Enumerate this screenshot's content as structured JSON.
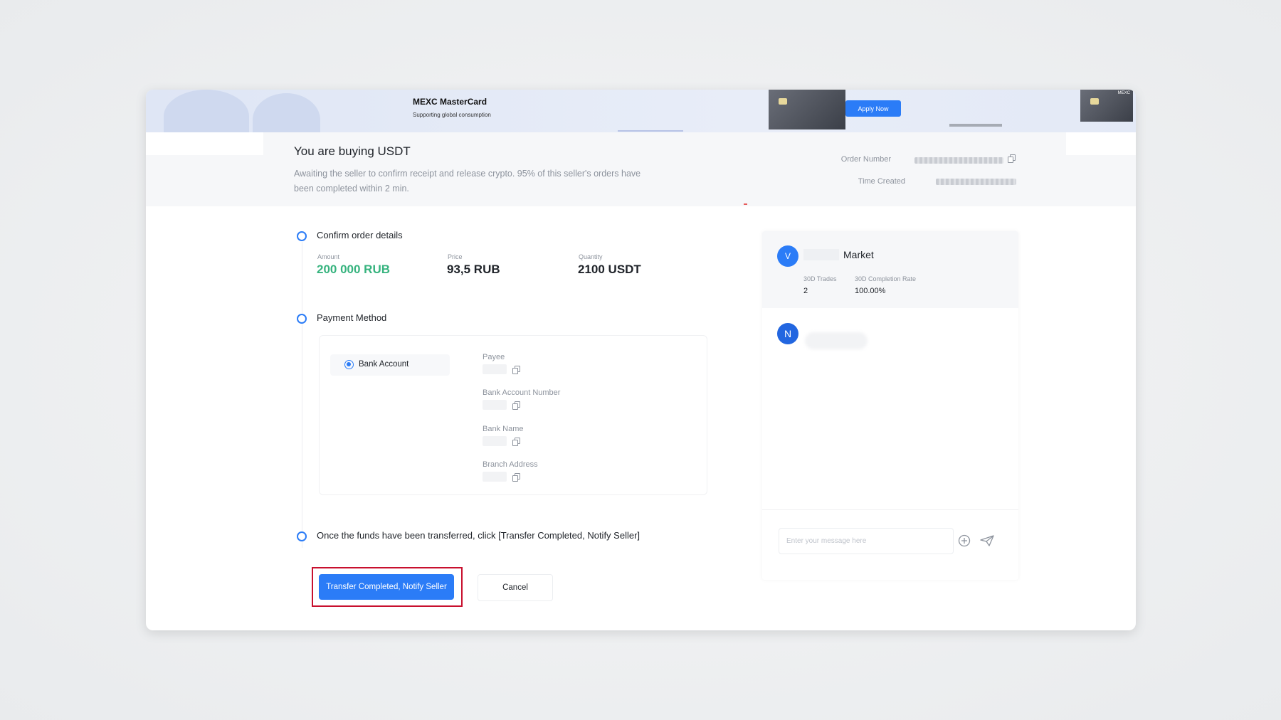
{
  "banner": {
    "title": "MEXC MasterCard",
    "subtitle": "Supporting global consumption",
    "apply_label": "Apply Now",
    "card_logo": "MEXC"
  },
  "order": {
    "title": "You are buying USDT",
    "description": "Awaiting the seller to confirm receipt and release crypto. 95% of this seller's orders have been completed within 2 min.",
    "order_number_label": "Order Number",
    "time_created_label": "Time Created"
  },
  "steps": {
    "confirm": {
      "label": "Confirm order details",
      "amount_label": "Amount",
      "amount_value": "200 000 RUB",
      "price_label": "Price",
      "price_value": "93,5 RUB",
      "quantity_label": "Quantity",
      "quantity_value": "2100 USDT"
    },
    "payment": {
      "label": "Payment Method",
      "method": "Bank Account",
      "fields": [
        "Payee",
        "Bank Account Number",
        "Bank Name",
        "Branch Address"
      ]
    },
    "transfer": {
      "label": "Once the funds have been transferred, click [Transfer Completed, Notify Seller]"
    }
  },
  "actions": {
    "primary_label": "Transfer Completed, Notify Seller",
    "cancel_label": "Cancel"
  },
  "chat": {
    "seller_initial": "V",
    "seller_name": "Market",
    "trades_label": "30D Trades",
    "trades_value": "2",
    "completion_label": "30D Completion Rate",
    "completion_value": "100.00%",
    "user_initial": "N",
    "input_placeholder": "Enter your message here"
  },
  "colors": {
    "accent": "#2b7cf7",
    "amount_green": "#36b37e",
    "highlight_red": "#c8102e"
  },
  "icons": [
    "copy-icon",
    "plus-circle-icon",
    "send-icon"
  ]
}
